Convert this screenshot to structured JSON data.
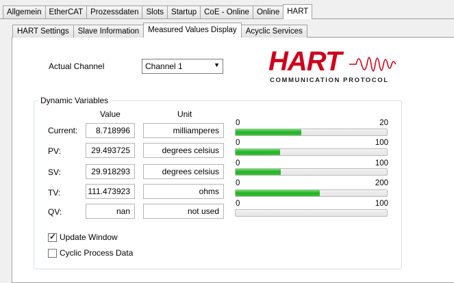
{
  "top_tabs": [
    "Allgemein",
    "EtherCAT",
    "Prozessdaten",
    "Slots",
    "Startup",
    "CoE - Online",
    "Online",
    "HART"
  ],
  "sub_tabs": [
    "HART Settings",
    "Slave Information",
    "Measured Values Display",
    "Acyclic Services"
  ],
  "actual_channel": {
    "label": "Actual Channel",
    "selected": "Channel 1"
  },
  "logo": {
    "word": "HART",
    "subtitle": "COMMUNICATION PROTOCOL"
  },
  "dynamic_variables": {
    "title": "Dynamic Variables",
    "value_header": "Value",
    "unit_header": "Unit",
    "rows": [
      {
        "label": "Current:",
        "value": "8.718996",
        "unit": "milliamperes",
        "min": "0",
        "max": "20",
        "fraction": 0.436
      },
      {
        "label": "PV:",
        "value": "29.493725",
        "unit": "degrees celsius",
        "min": "0",
        "max": "100",
        "fraction": 0.295
      },
      {
        "label": "SV:",
        "value": "29.918293",
        "unit": "degrees celsius",
        "min": "0",
        "max": "100",
        "fraction": 0.299
      },
      {
        "label": "TV:",
        "value": "111.473923",
        "unit": "ohms",
        "min": "0",
        "max": "200",
        "fraction": 0.557
      },
      {
        "label": "QV:",
        "value": "nan",
        "unit": "not used",
        "min": "0",
        "max": "100",
        "fraction": 0
      }
    ]
  },
  "options": {
    "update_window": {
      "label": "Update Window",
      "checked": true
    },
    "cyclic_process_data": {
      "label": "Cyclic Process Data",
      "checked": false
    }
  },
  "colors": {
    "bar_fill": "#22b022",
    "logo_red": "#d0021b"
  }
}
